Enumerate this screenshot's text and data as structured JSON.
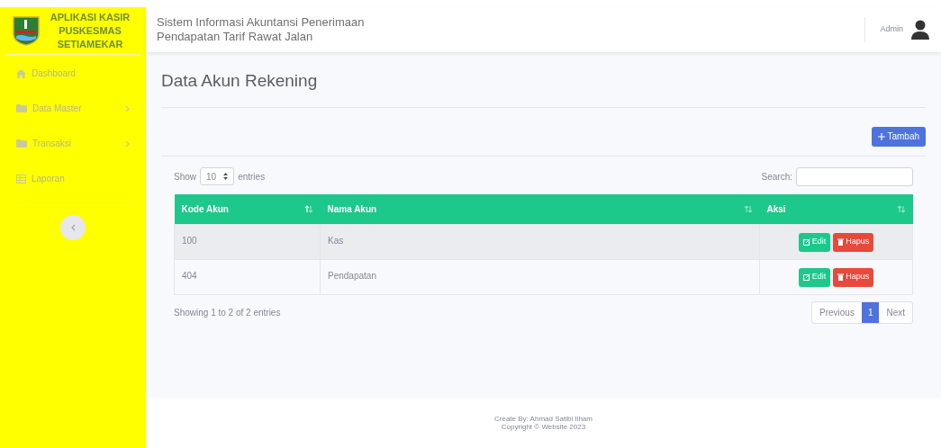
{
  "brand": {
    "title": "APLIKASI KASIR PUSKESMAS SETIAMEKAR"
  },
  "sidebar": {
    "items": [
      {
        "label": "Dashboard",
        "kind": "home",
        "expandable": false
      },
      {
        "label": "Data Master",
        "kind": "folder",
        "expandable": true
      },
      {
        "label": "Transaksi",
        "kind": "folder",
        "expandable": true
      },
      {
        "label": "Laporan",
        "kind": "table",
        "expandable": false
      }
    ]
  },
  "header": {
    "title": "Sistem Informasi Akuntansi Penerimaan Pendapatan Tarif Rawat Jalan",
    "user": "Admin"
  },
  "page": {
    "title": "Data Akun Rekening",
    "add_button": "Tambah"
  },
  "table_controls": {
    "show_label": "Show",
    "page_size": "10",
    "entries_label": "entries",
    "search_label": "Search:"
  },
  "table": {
    "columns": [
      {
        "label": "Kode Akun",
        "sorted": true
      },
      {
        "label": "Nama Akun",
        "sorted": false
      },
      {
        "label": "Aksi",
        "sorted": false
      }
    ],
    "rows": [
      {
        "cells": [
          "100",
          "Kas"
        ],
        "actions": [
          "Edit",
          "Hapus"
        ]
      },
      {
        "cells": [
          "404",
          "Pendapatan"
        ],
        "actions": [
          "Edit",
          "Hapus"
        ]
      }
    ]
  },
  "info": "Showing 1 to 2 of 2 entries",
  "pagination": {
    "previous": "Previous",
    "pages": [
      {
        "label": "1",
        "selected": true
      }
    ],
    "next": "Next"
  },
  "footer": [
    "Create By: Ahmad Satibi Ilham",
    "Copyright © Website 2023"
  ]
}
